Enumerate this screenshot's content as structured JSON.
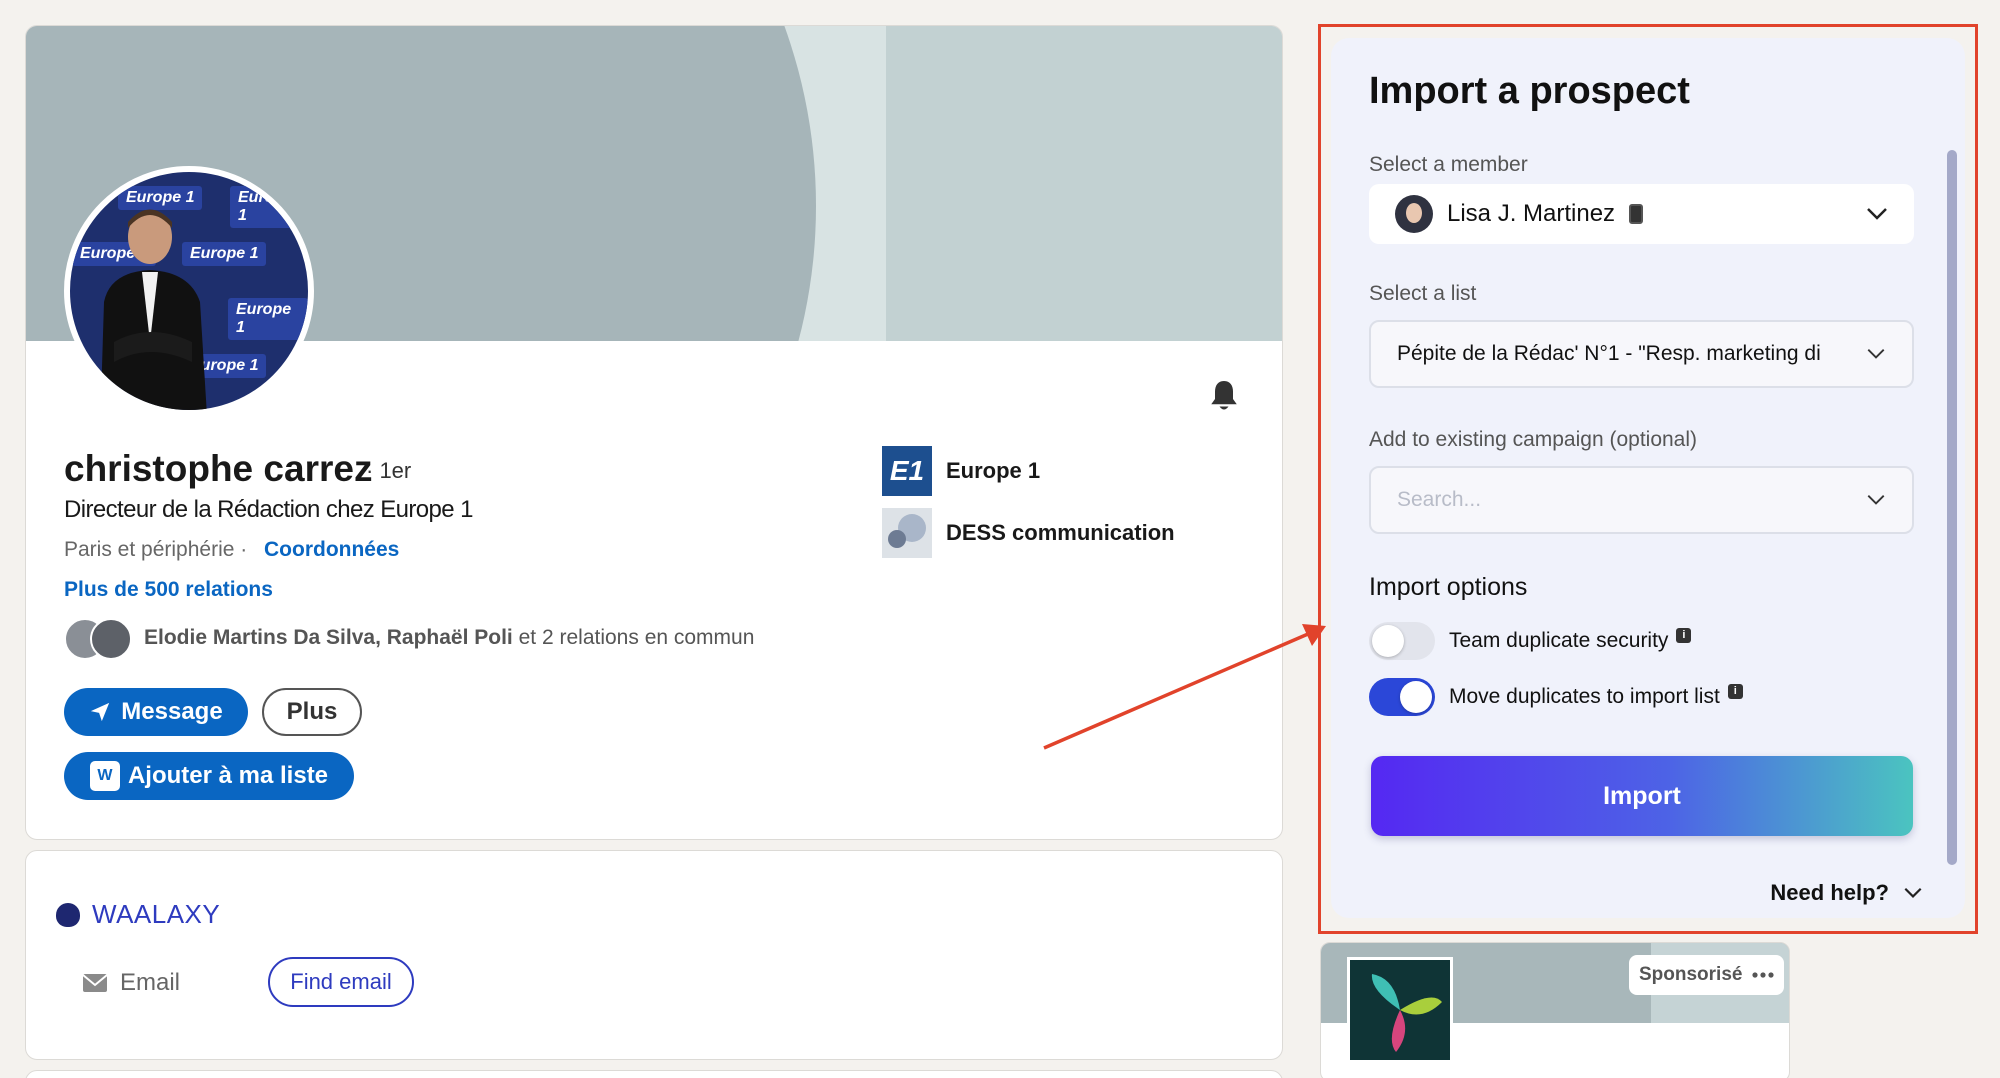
{
  "profile": {
    "name": "christophe carrez",
    "degree": "· 1er",
    "headline": "Directeur de la Rédaction chez Europe 1",
    "location": "Paris et périphérie ·",
    "contact_link": "Coordonnées",
    "relations": "Plus de 500 relations",
    "mutual_names": "Elodie Martins Da Silva, Raphaël Poli",
    "mutual_rest": " et 2 relations en commun",
    "message_button": "Message",
    "more_button": "Plus",
    "add_list_button": "Ajouter à ma liste",
    "avatar_tile_text": "Europe 1",
    "companies": [
      {
        "name": "Europe 1",
        "logo_text": "E1"
      },
      {
        "name": "DESS communication"
      }
    ]
  },
  "waalaxy": {
    "brand": "WAALAXY",
    "email_label": "Email",
    "find_email_button": "Find email"
  },
  "import_panel": {
    "title": "Import a prospect",
    "member_label": "Select a member",
    "member_value": "Lisa J. Martinez",
    "list_label": "Select a list",
    "list_value": "Pépite de la Rédac' N°1 - \"Resp. marketing di",
    "campaign_label": "Add to existing campaign (optional)",
    "campaign_placeholder": "Search...",
    "options_title": "Import options",
    "options": [
      {
        "label": "Team duplicate security",
        "enabled": false
      },
      {
        "label": "Move duplicates to import list",
        "enabled": true
      }
    ],
    "info_glyph": "i",
    "import_button": "Import",
    "help_link": "Need help?"
  },
  "sponsored": {
    "label": "Sponsorisé"
  },
  "colors": {
    "linkedin_blue": "#0a66c2",
    "waalaxy_blue": "#2e3bbf",
    "highlight_red": "#e1432b",
    "toggle_on": "#2b47d8"
  }
}
